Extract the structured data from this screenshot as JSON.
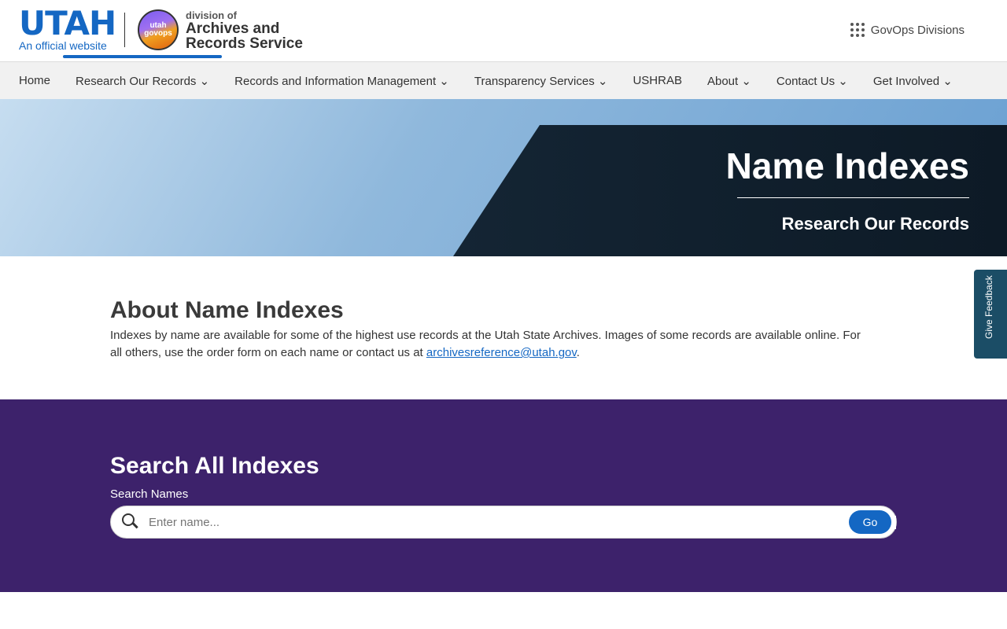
{
  "header": {
    "state": "UTAH",
    "official": "An official website",
    "badge": "utah govops",
    "division_of": "division of",
    "division_name_1": "Archives and",
    "division_name_2": "Records Service",
    "govops": "GovOps Divisions"
  },
  "nav": {
    "items": [
      {
        "label": "Home"
      },
      {
        "label": "Research Our Records ⌄"
      },
      {
        "label": "Records and Information Management ⌄"
      },
      {
        "label": "Transparency Services ⌄"
      },
      {
        "label": "USHRAB"
      },
      {
        "label": "About ⌄"
      },
      {
        "label": "Contact Us ⌄"
      },
      {
        "label": "Get Involved ⌄"
      }
    ]
  },
  "hero": {
    "title": "Name Indexes",
    "subtitle": "Research Our Records"
  },
  "about": {
    "heading": "About Name Indexes",
    "text": "Indexes by name are available for some of the highest use records at the Utah State Archives. Images of some records are available online. For all others, use the order form on each name or contact us at ",
    "email": "archivesreference@utah.gov",
    "end": "."
  },
  "search": {
    "heading": "Search All Indexes",
    "label": "Search Names",
    "placeholder": "Enter name...",
    "go": "Go"
  },
  "feedback": {
    "label": "Give Feedback"
  }
}
